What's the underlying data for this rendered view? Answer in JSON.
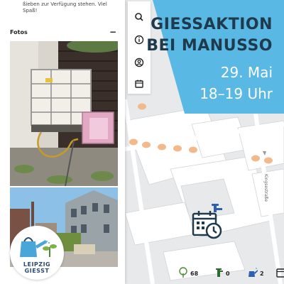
{
  "panel": {
    "intro_line1": "ßieben zur Verfügung stehen. Viel",
    "intro_line2": "Spaß!",
    "photos_title": "Fotos",
    "collapse_symbol": "−"
  },
  "announcement": {
    "line1": "GIESSAKTION",
    "line2": "BEI MANUSSO",
    "date": "29. Mai",
    "time": "18–19 Uhr"
  },
  "logo": {
    "line1": "LEIPZIG",
    "line2": "GIESST"
  },
  "map": {
    "street_label": "Kingsestraße"
  },
  "stats": {
    "trees": "68",
    "pumps": "0",
    "waterings": "2"
  },
  "toolbar": {
    "icons": [
      "search-icon",
      "info-icon",
      "profile-icon",
      "calendar-icon"
    ]
  },
  "colors": {
    "banner": "#5ab8e4",
    "banner_dark_text": "#1f3a4d",
    "tree_dots": "#f3b98a",
    "event_icon": "#1f3a4d",
    "pump_icon": "#2d5fb0"
  }
}
